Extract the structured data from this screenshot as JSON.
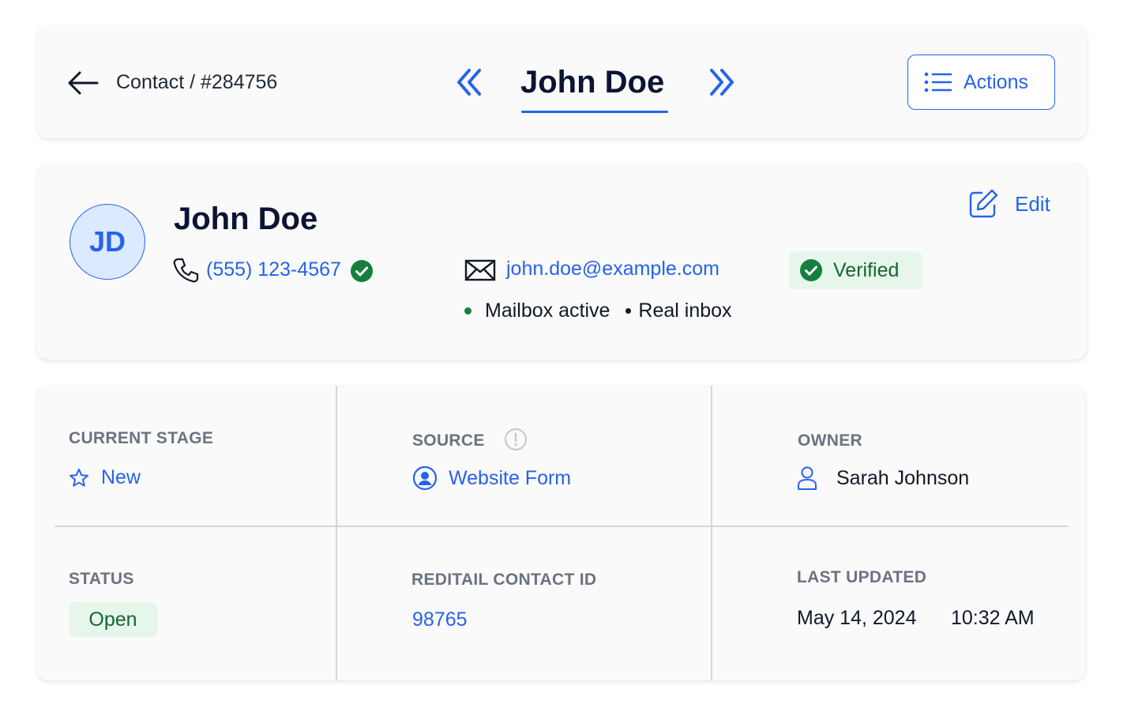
{
  "header": {
    "breadcrumb": "Contact / #284756",
    "title": "John Doe",
    "actions_label": "Actions",
    "icons": {
      "back": "arrow-left-icon",
      "prev": "chevrons-left-icon",
      "next": "chevrons-right-icon",
      "actions": "list-icon"
    }
  },
  "profile": {
    "avatar_initials": "JD",
    "name": "John Doe",
    "edit_label": "Edit",
    "phone": "(555) 123-4567",
    "email": "john.doe@example.com",
    "verified_label": "Verified",
    "mailbox_status": "Mailbox active",
    "inbox_type": "Real inbox",
    "icons": {
      "edit": "edit-icon",
      "phone": "phone-icon",
      "phone_verified": "check-circle-icon",
      "email": "mail-icon",
      "verified": "check-circle-icon"
    }
  },
  "details": {
    "current_stage": {
      "label": "CURRENT STAGE",
      "value": "New",
      "icon": "star-icon"
    },
    "source": {
      "label": "SOURCE",
      "value": "Website Form",
      "icon": "user-circle-icon",
      "info_icon": "info-icon"
    },
    "owner": {
      "label": "OWNER",
      "value": "Sarah Johnson",
      "icon": "user-icon"
    },
    "status": {
      "label": "STATUS",
      "value": "Open"
    },
    "contact_id": {
      "label": "REDITAIL CONTACT ID",
      "value": "98765"
    },
    "last_updated": {
      "label": "LAST UPDATED",
      "date": "May 14, 2024",
      "time": "10:32 AM"
    }
  },
  "colors": {
    "accent": "#2563eb",
    "success": "#15803d",
    "success_bg": "#e6f6ea",
    "muted": "#6b7280"
  }
}
